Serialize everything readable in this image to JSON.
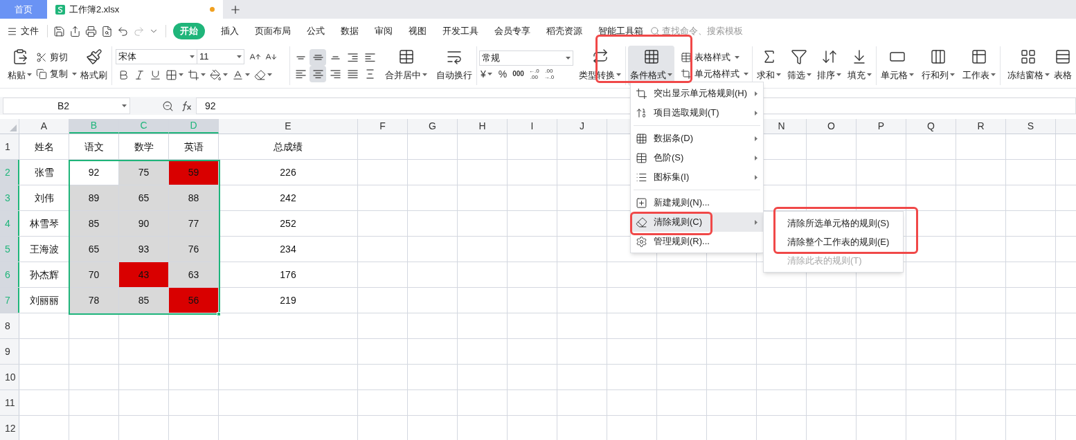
{
  "tabs": [
    {
      "label": "首页",
      "kind": "home",
      "selected": false
    },
    {
      "label": "工作簿2.xlsx",
      "kind": "workbook",
      "selected": true,
      "modified": true
    }
  ],
  "menu_bar": {
    "file": "文件",
    "search_placeholder": "查找命令、搜索模板",
    "tabs": [
      {
        "label": "开始",
        "selected": true
      },
      {
        "label": "插入",
        "selected": false
      },
      {
        "label": "页面布局",
        "selected": false
      },
      {
        "label": "公式",
        "selected": false
      },
      {
        "label": "数据",
        "selected": false
      },
      {
        "label": "审阅",
        "selected": false
      },
      {
        "label": "视图",
        "selected": false
      },
      {
        "label": "开发工具",
        "selected": false
      },
      {
        "label": "会员专享",
        "selected": false
      },
      {
        "label": "稻壳资源",
        "selected": false
      },
      {
        "label": "智能工具箱",
        "selected": false
      }
    ]
  },
  "ribbon": {
    "paste": "粘贴",
    "cut": "剪切",
    "copy": "复制",
    "format_painter": "格式刷",
    "font_name": "宋体",
    "font_size": "11",
    "vertical_align": [
      {
        "selected": false
      },
      {
        "selected": true
      },
      {
        "selected": false
      }
    ],
    "horizontal_align": [
      {
        "selected": false
      },
      {
        "selected": true
      },
      {
        "selected": false
      },
      {
        "selected": false
      },
      {
        "selected": false
      }
    ],
    "merge": "合并居中",
    "wrap": "自动换行",
    "number_format": "常规",
    "currency": "¥",
    "percent": "%",
    "thousands": "000",
    "decimal_more": [
      "←.0",
      ".00"
    ],
    "decimal_less": [
      ".00",
      "→.0"
    ],
    "convert": "类型转换",
    "conditional_format": {
      "label": "条件格式",
      "selected": true
    },
    "table_style": "表格样式",
    "cell_style": "单元格样式",
    "tools": [
      "求和",
      "筛选",
      "排序",
      "填充",
      "单元格",
      "行和列",
      "工作表",
      "冻结窗格",
      "表格"
    ]
  },
  "formula_bar": {
    "cell_ref": "B2",
    "formula": "92"
  },
  "sheet": {
    "columns": [
      {
        "label": "A",
        "selected": false
      },
      {
        "label": "B",
        "selected": true
      },
      {
        "label": "C",
        "selected": true
      },
      {
        "label": "D",
        "selected": true
      },
      {
        "label": "E",
        "selected": false
      },
      {
        "label": "F",
        "selected": false
      },
      {
        "label": "G",
        "selected": false
      },
      {
        "label": "H",
        "selected": false
      },
      {
        "label": "I",
        "selected": false
      },
      {
        "label": "J",
        "selected": false
      }
    ],
    "columns_right": [
      "N",
      "O",
      "P",
      "Q",
      "R",
      "S"
    ],
    "rows": [
      {
        "header": "1",
        "selected": false,
        "cells": [
          {
            "text": "姓名"
          },
          {
            "text": "语文"
          },
          {
            "text": "数学"
          },
          {
            "text": "英语"
          },
          {
            "text": "总成绩"
          }
        ]
      },
      {
        "header": "2",
        "selected": true,
        "cells": [
          {
            "text": "张雪"
          },
          {
            "text": "92"
          },
          {
            "text": "75",
            "color": "#d9d9d9"
          },
          {
            "text": "59",
            "color": "#d90000"
          },
          {
            "text": "226"
          }
        ]
      },
      {
        "header": "3",
        "selected": true,
        "cells": [
          {
            "text": "刘伟"
          },
          {
            "text": "89",
            "color": "#d9d9d9"
          },
          {
            "text": "65",
            "color": "#d9d9d9"
          },
          {
            "text": "88",
            "color": "#d9d9d9"
          },
          {
            "text": "242"
          }
        ]
      },
      {
        "header": "4",
        "selected": true,
        "cells": [
          {
            "text": "林雪琴"
          },
          {
            "text": "85",
            "color": "#d9d9d9"
          },
          {
            "text": "90",
            "color": "#d9d9d9"
          },
          {
            "text": "77",
            "color": "#d9d9d9"
          },
          {
            "text": "252"
          }
        ]
      },
      {
        "header": "5",
        "selected": true,
        "cells": [
          {
            "text": "王海波"
          },
          {
            "text": "65",
            "color": "#d9d9d9"
          },
          {
            "text": "93",
            "color": "#d9d9d9"
          },
          {
            "text": "76",
            "color": "#d9d9d9"
          },
          {
            "text": "234"
          }
        ]
      },
      {
        "header": "6",
        "selected": true,
        "cells": [
          {
            "text": "孙杰辉"
          },
          {
            "text": "70",
            "color": "#d9d9d9"
          },
          {
            "text": "43",
            "color": "#d90000"
          },
          {
            "text": "63",
            "color": "#d9d9d9"
          },
          {
            "text": "176"
          }
        ]
      },
      {
        "header": "7",
        "selected": true,
        "cells": [
          {
            "text": "刘丽丽"
          },
          {
            "text": "78",
            "color": "#d9d9d9"
          },
          {
            "text": "85",
            "color": "#d9d9d9"
          },
          {
            "text": "56",
            "color": "#d90000"
          },
          {
            "text": "219"
          }
        ]
      },
      {
        "header": "8",
        "selected": false
      },
      {
        "header": "9",
        "selected": false
      },
      {
        "header": "10",
        "selected": false
      },
      {
        "header": "11",
        "selected": false
      },
      {
        "header": "12",
        "selected": false
      }
    ]
  },
  "dropdown": [
    {
      "label": "突出显示单元格规则(H)",
      "submenu": true,
      "selected": false,
      "divider_before": false
    },
    {
      "label": "项目选取规则(T)",
      "submenu": true,
      "selected": false,
      "divider_before": false
    },
    {
      "label": "数据条(D)",
      "submenu": true,
      "selected": false,
      "divider_before": true
    },
    {
      "label": "色阶(S)",
      "submenu": true,
      "selected": false,
      "divider_before": false
    },
    {
      "label": "图标集(I)",
      "submenu": true,
      "selected": false,
      "divider_before": false
    },
    {
      "label": "新建规则(N)...",
      "submenu": false,
      "selected": false,
      "divider_before": true
    },
    {
      "label": "清除规则(C)",
      "submenu": true,
      "selected": true,
      "divider_before": false
    },
    {
      "label": "管理规则(R)...",
      "submenu": false,
      "selected": false,
      "divider_before": false
    }
  ],
  "submenu": [
    {
      "label": "清除所选单元格的规则(S)",
      "disabled": false
    },
    {
      "label": "清除整个工作表的规则(E)",
      "disabled": false
    },
    {
      "label": "清除此表的规则(T)",
      "disabled": true
    }
  ]
}
